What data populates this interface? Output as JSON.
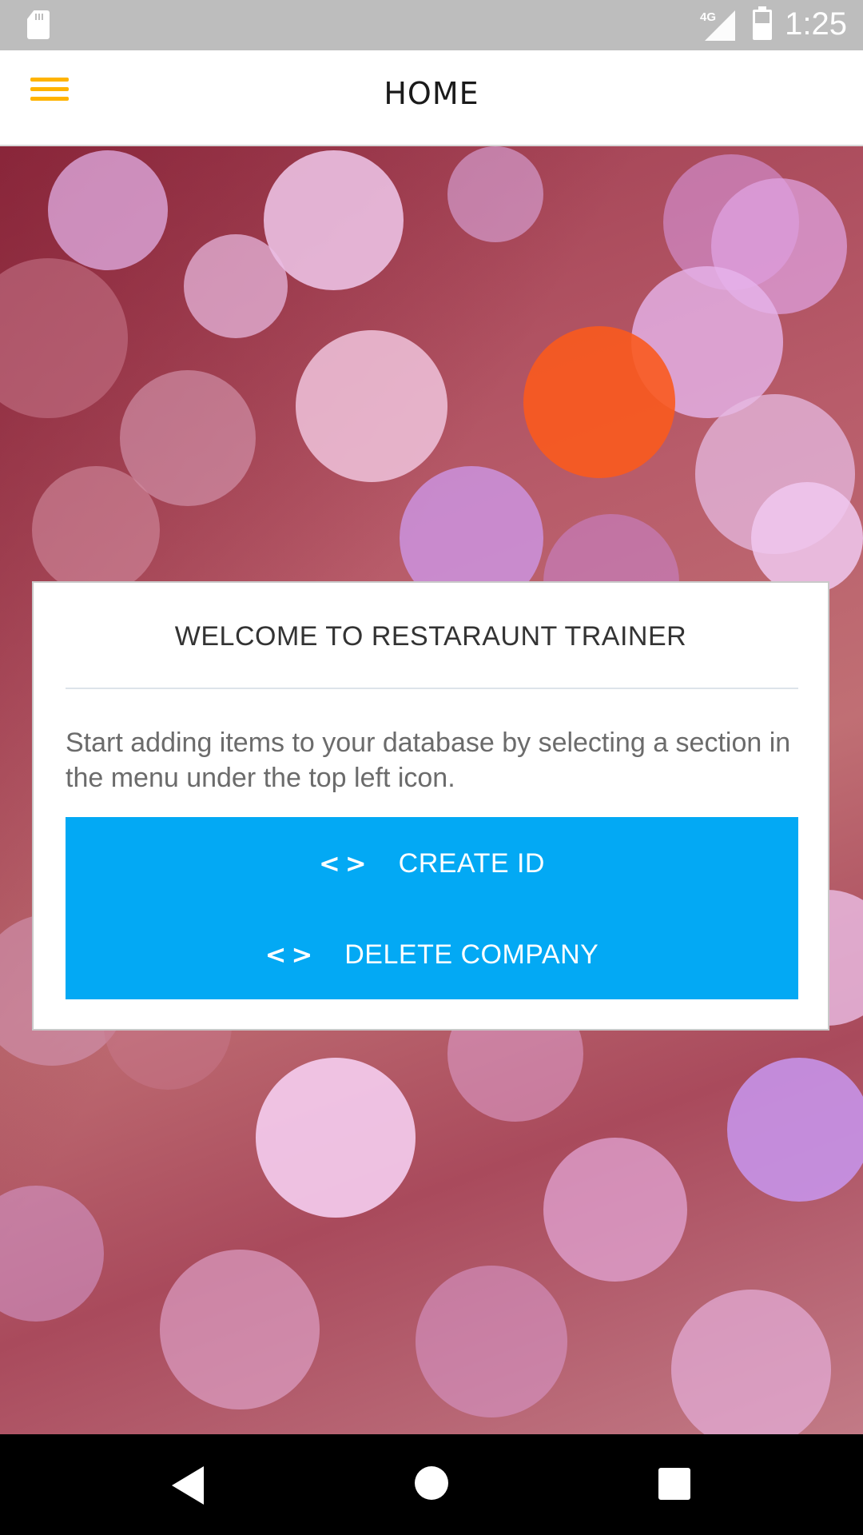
{
  "status_bar": {
    "network": "4G",
    "time": "1:25",
    "icons": [
      "sd-card-icon",
      "signal-icon",
      "battery-icon"
    ]
  },
  "app_bar": {
    "menu_icon": "hamburger-menu-icon",
    "title": "HOME",
    "accent_color": "#ffb300"
  },
  "card": {
    "title": "WELCOME TO RESTARAUNT TRAINER",
    "body": "Start adding items to your database by selecting a section in the menu under the top left icon.",
    "buttons": [
      {
        "icon": "<>",
        "label": "CREATE ID"
      },
      {
        "icon": "<>",
        "label": "DELETE COMPANY"
      }
    ],
    "button_color": "#03a9f4"
  },
  "nav_bar": {
    "icons": [
      "back-icon",
      "home-icon",
      "recents-icon"
    ]
  }
}
